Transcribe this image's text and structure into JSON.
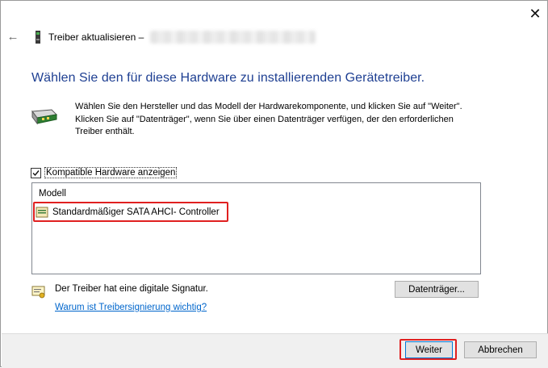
{
  "window": {
    "title": "Treiber aktualisieren –",
    "close_glyph": "✕",
    "back_glyph": "←"
  },
  "heading": "Wählen Sie den für diese Hardware zu installierenden Gerätetreiber.",
  "intro_text": "Wählen Sie den Hersteller und das Modell der Hardwarekomponente, und klicken Sie auf \"Weiter\". Klicken Sie auf \"Datenträger\", wenn Sie über einen Datenträger verfügen, der den erforderlichen Treiber enthält.",
  "compatible_checkbox": {
    "label": "Kompatible Hardware anzeigen",
    "checked": true
  },
  "model_list": {
    "column_header": "Modell",
    "items": [
      {
        "label": "Standardmäßiger SATA AHCI- Controller"
      }
    ]
  },
  "signature": {
    "text": "Der Treiber hat eine digitale Signatur.",
    "link": "Warum ist Treibersignierung wichtig?"
  },
  "buttons": {
    "disk": "Datenträger...",
    "next": "Weiter",
    "cancel": "Abbrechen"
  },
  "colors": {
    "heading": "#1e3f92",
    "link": "#0066cc",
    "highlight": "#e02020",
    "footer_bg": "#f0f0f0"
  },
  "icons": [
    "back-arrow-icon",
    "device-icon",
    "hardware-card-icon",
    "driver-item-icon",
    "certificate-icon",
    "close-icon"
  ]
}
